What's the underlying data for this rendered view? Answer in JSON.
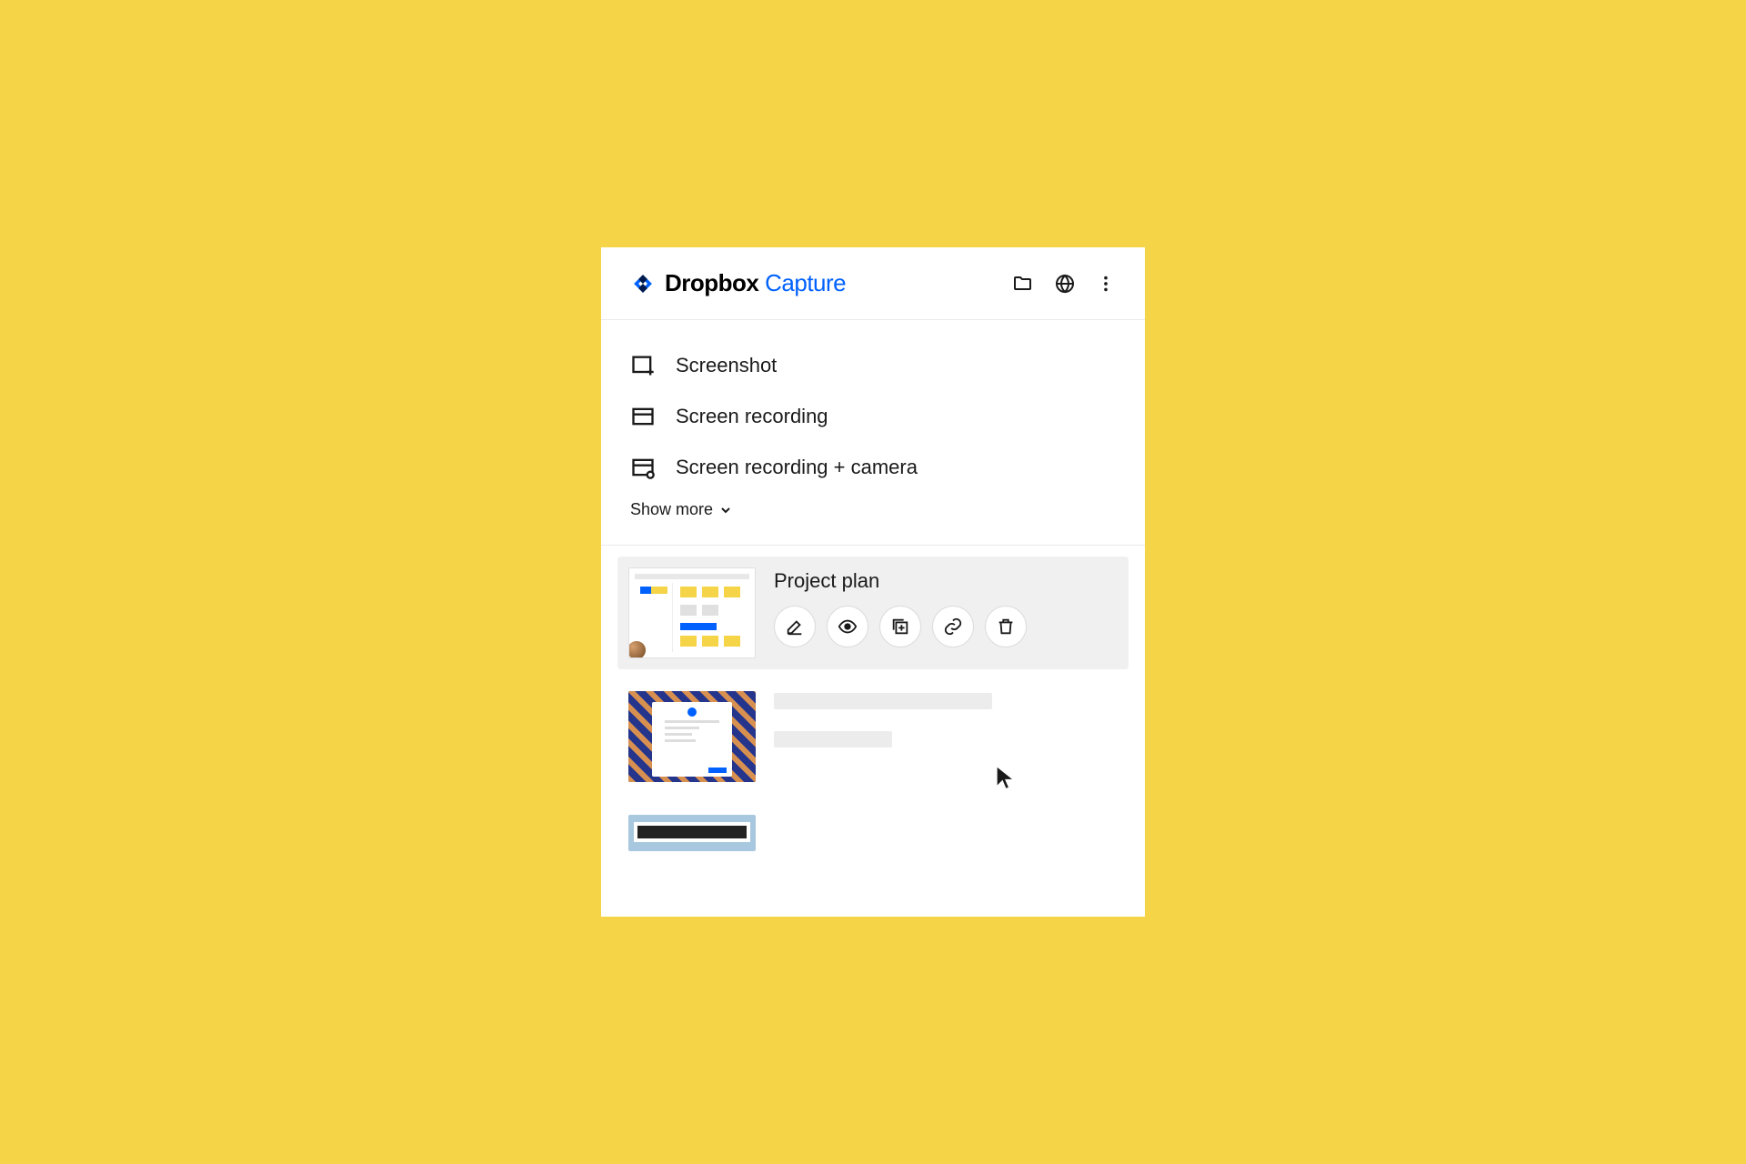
{
  "brand": {
    "main": "Dropbox",
    "sub": "Capture"
  },
  "header_icons": {
    "folder": "folder",
    "globe": "globe",
    "menu": "more"
  },
  "options": [
    {
      "label": "Screenshot",
      "icon": "screenshot"
    },
    {
      "label": "Screen recording",
      "icon": "screen-recording"
    },
    {
      "label": "Screen recording + camera",
      "icon": "screen-recording-camera"
    }
  ],
  "show_more_label": "Show more",
  "captures": [
    {
      "title": "Project plan",
      "active": true,
      "actions": [
        "edit",
        "view",
        "add-to-collection",
        "link",
        "delete"
      ]
    },
    {
      "title": "",
      "active": false
    },
    {
      "title": "",
      "active": false
    }
  ]
}
